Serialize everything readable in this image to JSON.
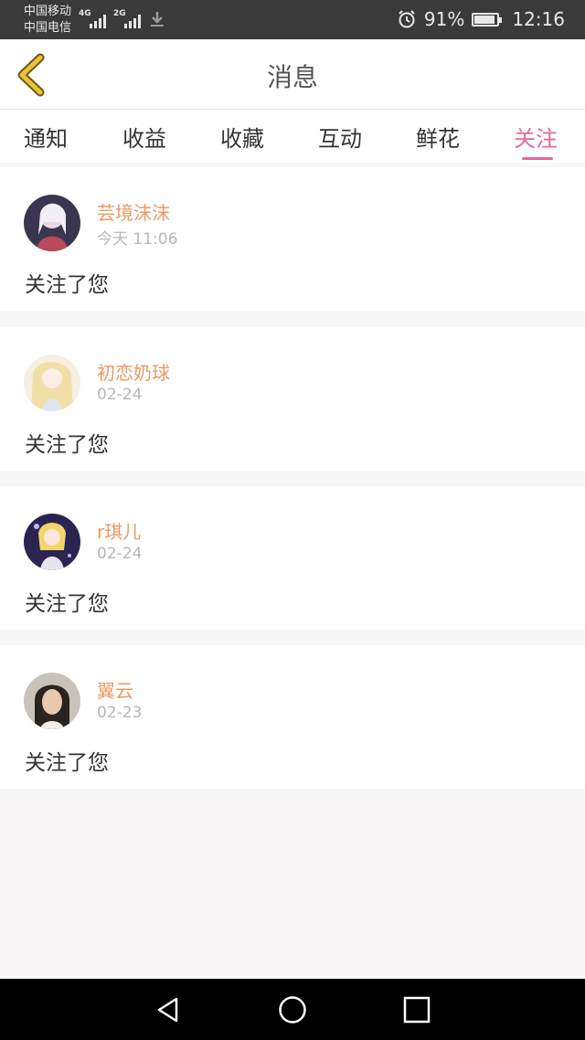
{
  "status_bar": {
    "carrier_1": "中国移动",
    "carrier_2": "中国电信",
    "network_1": "4G",
    "network_2": "2G",
    "battery_percent_text": "91%",
    "battery_level": 0.91,
    "time": "12:16"
  },
  "header": {
    "title": "消息",
    "back_icon": "chevron-left-icon",
    "accent_color": "#e8c23a"
  },
  "tabs": [
    {
      "label": "通知",
      "active": false
    },
    {
      "label": "收益",
      "active": false
    },
    {
      "label": "收藏",
      "active": false
    },
    {
      "label": "互动",
      "active": false
    },
    {
      "label": "鲜花",
      "active": false
    },
    {
      "label": "关注",
      "active": true
    }
  ],
  "active_tab_color": "#e8679c",
  "messages": [
    {
      "user": "芸境沫沫",
      "time": "今天 11:06",
      "text": "关注了您"
    },
    {
      "user": "初恋奶球",
      "time": "02-24",
      "text": "关注了您"
    },
    {
      "user": "r琪儿",
      "time": "02-24",
      "text": "关注了您"
    },
    {
      "user": "翼云",
      "time": "02-23",
      "text": "关注了您"
    }
  ],
  "nav_bar": {
    "back_icon": "triangle-back-icon",
    "home_icon": "circle-home-icon",
    "recents_icon": "square-recents-icon"
  }
}
